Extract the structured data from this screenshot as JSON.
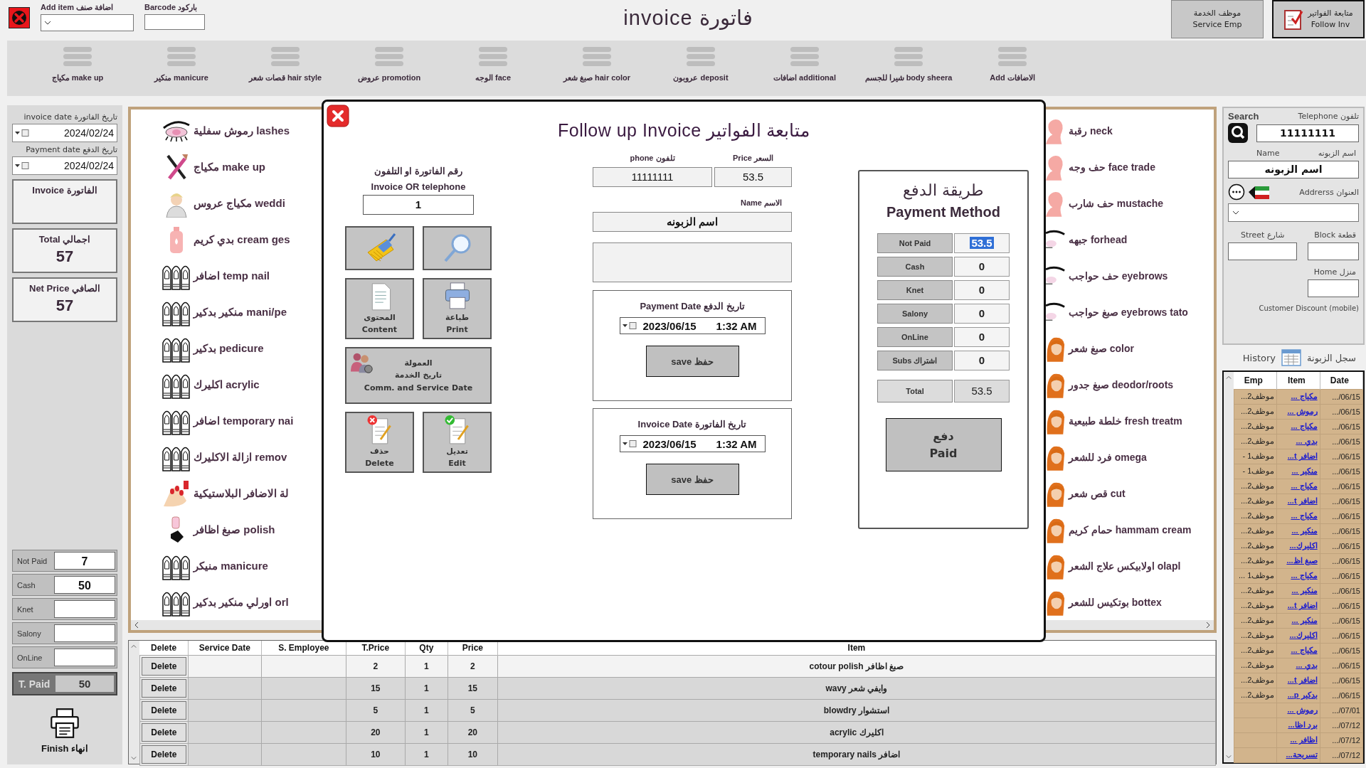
{
  "top_bar": {
    "add_item": {
      "label": "Add item اضافة صنف"
    },
    "barcode": {
      "label": "Barcode باركود"
    },
    "title": "invoice فاتورة",
    "buttons": [
      {
        "kind": "checklist",
        "arabic": "متابعة الفواتير",
        "english": "Follow Inv",
        "pressed": true
      },
      {
        "kind": "plain",
        "arabic": "موظف الخدمة",
        "english": "Service Emp",
        "pressed": false
      }
    ]
  },
  "categories": [
    {
      "label": "Add الاضافات"
    },
    {
      "label": "شيرا للجسم body sheera"
    },
    {
      "label": "اضافات additional"
    },
    {
      "label": "عروبون deposit"
    },
    {
      "label": "صبغ شعر hair color"
    },
    {
      "label": "الوجه face"
    },
    {
      "label": "عروض  promotion"
    },
    {
      "label": "قصات شعر hair style"
    },
    {
      "label": "منكير manicure"
    },
    {
      "label": "مكياج make up"
    }
  ],
  "sidebar": {
    "invoice_date": {
      "label": "invoice date  تاريخ الفاتورة",
      "value": "2024/02/24"
    },
    "payment_date": {
      "label": "Payment date  تاريخ الدفع",
      "value": "2024/02/24"
    },
    "invoice_box": {
      "label": "Invoice الفاتورة"
    },
    "total": {
      "label": "Total اجمالي",
      "value": "57"
    },
    "net_price": {
      "label": "Net Price الصافي",
      "value": "57"
    },
    "payments": [
      {
        "label": "Not Paid",
        "value": "7"
      },
      {
        "label": "Cash",
        "value": "50"
      },
      {
        "label": "Knet"
      },
      {
        "label": "Salony"
      },
      {
        "label": "OnLine"
      }
    ],
    "total_paid": {
      "label": "T. Paid",
      "value": "50"
    },
    "finish_button": {
      "label": "Finish انهاء"
    }
  },
  "services_left": [
    {
      "kind": "eye",
      "label": "رموش سفلية lashes"
    },
    {
      "kind": "brush",
      "label": "مكياج make up"
    },
    {
      "kind": "bride",
      "label": "مكياج عروس weddi"
    },
    {
      "kind": "bottle",
      "label": "بدي كريم cream ges"
    },
    {
      "kind": "nails",
      "label": "اضافر temp nail"
    },
    {
      "kind": "nails",
      "label": "منكير بدكير mani/pe"
    },
    {
      "kind": "nails",
      "label": "بدكير pedicure"
    },
    {
      "kind": "nails",
      "label": "اكليرك acrylic"
    },
    {
      "kind": "nails",
      "label": "اضافر temporary nai"
    },
    {
      "kind": "nails",
      "label": "ازالة الاكليرك remov"
    },
    {
      "kind": "hand",
      "label": "لة الاضافر البلاستيكية"
    },
    {
      "kind": "polish",
      "label": "صبغ اظافر polish"
    },
    {
      "kind": "nails",
      "label": "منيكر manicure"
    },
    {
      "kind": "nails",
      "label": "اورلي منكير بدكير orl"
    }
  ],
  "services_right": [
    {
      "kind": "face",
      "label": "رقبة neck"
    },
    {
      "kind": "face",
      "label": "حف وجه face trade"
    },
    {
      "kind": "face",
      "label": "حف شارب mustache"
    },
    {
      "kind": "brow",
      "label": "جبهه forhead"
    },
    {
      "kind": "brow",
      "label": "حف حواجب eyebrows"
    },
    {
      "kind": "brow",
      "label": "صبغ حواجب eyebrows tato"
    },
    {
      "kind": "hair",
      "label": "صبغ شعر color"
    },
    {
      "kind": "hair",
      "label": "صبغ جدور deodor/roots"
    },
    {
      "kind": "hair",
      "label": "خلطة طبيعية fresh treatm"
    },
    {
      "kind": "hair",
      "label": "فرد للشعر omega"
    },
    {
      "kind": "hair",
      "label": "قص شعر cut"
    },
    {
      "kind": "hair",
      "label": "حمام كريم hammam cream"
    },
    {
      "kind": "hair",
      "label": "اولابيكس علاج الشعر olapl"
    },
    {
      "kind": "hair",
      "label": "بوتكيس للشعر  bottex"
    }
  ],
  "dialog": {
    "title": "Follow up Invoice متابعة الفواتير",
    "search": {
      "label_arabic": "رقم الفاتورة او التلفون",
      "label_english": "Invoice OR telephone",
      "value": "1"
    },
    "actions": [
      {
        "kind": "search"
      },
      {
        "kind": "clear"
      },
      {
        "kind": "print",
        "lines": [
          "طباعة",
          "Print"
        ]
      },
      {
        "kind": "content",
        "lines": [
          "المحتوى",
          "Content"
        ]
      },
      {
        "kind": "commission",
        "lines": [
          "العمولة",
          "تاريخ الخدمة",
          "Comm. and Service Date"
        ]
      },
      {
        "kind": "edit",
        "lines": [
          "تعديل",
          "Edit"
        ]
      },
      {
        "kind": "delete",
        "lines": [
          "حذف",
          "Delete"
        ]
      }
    ],
    "phone": {
      "label": "phone تلفون",
      "value": "11111111"
    },
    "price": {
      "label": "Price السعر",
      "value": "53.5"
    },
    "name": {
      "label": "Name الاسم",
      "value": "اسم الزبونه"
    },
    "date_sections": [
      {
        "label": "Payment Date تاريخ الدفع",
        "date": "2023/06/15",
        "time": "1:32 AM",
        "save_button": "save حفظ"
      },
      {
        "label": "Invoice Date تاريخ الفاتورة",
        "date": "2023/06/15",
        "time": "1:32 AM",
        "save_button": "save حفظ"
      }
    ],
    "payment_method": {
      "title_arabic": "طريقة الدفع",
      "title_english": "Payment Method",
      "rows": [
        {
          "label": "Not Paid",
          "value": "53.5",
          "selected": true
        },
        {
          "label": "Cash",
          "value": "0",
          "selected": false
        },
        {
          "label": "Knet",
          "value": "0",
          "selected": false
        },
        {
          "label": "Salony",
          "value": "0",
          "selected": false
        },
        {
          "label": "OnLine",
          "value": "0",
          "selected": false
        },
        {
          "label": "Subs اشتراك",
          "value": "0",
          "selected": false
        }
      ],
      "total": {
        "label": "Total",
        "value": "53.5"
      },
      "paid_button": {
        "arabic": "دفع",
        "english": "Paid"
      }
    }
  },
  "customer": {
    "search_label": "Search",
    "telephone_label": "Telephone تلفون",
    "telephone": "11111111",
    "name_label_english": "Name",
    "name_label_arabic": "اسم الزبونه",
    "name": "اسم الزبونه",
    "address_label": "Addrerss العنوان",
    "street_label": "Street شارع",
    "block_label": "Block قطعة",
    "home_label": "Home منزل",
    "discount_label": "Customer Discount (mobile)"
  },
  "history": {
    "label_english": "History",
    "label_arabic": "سجل الزبونة",
    "columns": [
      "Date",
      "Item",
      "Emp"
    ],
    "rows": [
      {
        "emp": "موظف2...",
        "item": "مكياج ...",
        "date": ".../06/15"
      },
      {
        "emp": "موظف2...",
        "item": "رموش ...",
        "date": ".../06/15"
      },
      {
        "emp": "موظف2...",
        "item": "مكياج ...",
        "date": ".../06/15"
      },
      {
        "emp": "موظف2...",
        "item": "بدي ...",
        "date": ".../06/15"
      },
      {
        "emp": "موظف1 -",
        "item": "اضافر t...",
        "date": ".../06/15"
      },
      {
        "emp": "موظف1 -",
        "item": "منكير ...",
        "date": ".../06/15"
      },
      {
        "emp": "موظف2...",
        "item": "مكياج ...",
        "date": ".../06/15"
      },
      {
        "emp": "موظف2...",
        "item": "اضافر t...",
        "date": ".../06/15"
      },
      {
        "emp": "موظف2...",
        "item": "مكياج ...",
        "date": ".../06/15"
      },
      {
        "emp": "موظف2...",
        "item": "منكير ...",
        "date": ".../06/15"
      },
      {
        "emp": "موظف2...",
        "item": "اكليرك...",
        "date": ".../06/15"
      },
      {
        "emp": "موظف2...",
        "item": "صبغ اظ...",
        "date": ".../06/15"
      },
      {
        "emp": "موظف1 ...",
        "item": "مكياج ...",
        "date": ".../06/15"
      },
      {
        "emp": "موظف2...",
        "item": "منكير ...",
        "date": ".../06/15"
      },
      {
        "emp": "موظف2...",
        "item": "اضافر t...",
        "date": ".../06/15"
      },
      {
        "emp": "موظف2...",
        "item": "منكير ...",
        "date": ".../06/15"
      },
      {
        "emp": "موظف2...",
        "item": "اكليرك...",
        "date": ".../06/15"
      },
      {
        "emp": "موظف2...",
        "item": "مكياج ...",
        "date": ".../06/15"
      },
      {
        "emp": "موظف2...",
        "item": "بدي ...",
        "date": ".../06/15"
      },
      {
        "emp": "موظف2...",
        "item": "اضافر t...",
        "date": ".../06/15"
      },
      {
        "emp": "موظف2...",
        "item": "بدكير p...",
        "date": ".../06/15"
      },
      {
        "item": "رموش ...",
        "date": ".../07/01"
      },
      {
        "item": "برد اظا...",
        "date": ".../07/12"
      },
      {
        "item": "اظافر ...",
        "date": ".../07/12"
      },
      {
        "item": "تسريحة...",
        "date": ".../07/12"
      }
    ]
  },
  "invoice_table": {
    "columns": [
      "Item",
      "Price",
      "Qty",
      "T.Price",
      "S. Employee",
      "Service Date",
      "Delete"
    ],
    "rows": [
      {
        "delete": "Delete",
        "total_price": "2",
        "qty": "1",
        "price": "2",
        "item": "cotour polish صبغ اظافر",
        "selected": true
      },
      {
        "delete": "Delete",
        "total_price": "15",
        "qty": "1",
        "price": "15",
        "item": "wavy وايفي شعر",
        "selected": false
      },
      {
        "delete": "Delete",
        "total_price": "5",
        "qty": "1",
        "price": "5",
        "item": "blowdry استشوار",
        "selected": false
      },
      {
        "delete": "Delete",
        "total_price": "20",
        "qty": "1",
        "price": "20",
        "item": "acrylic اكليرك",
        "selected": false
      },
      {
        "delete": "Delete",
        "total_price": "10",
        "qty": "1",
        "price": "10",
        "item": "temporary nails اضافر",
        "selected": false
      }
    ]
  }
}
